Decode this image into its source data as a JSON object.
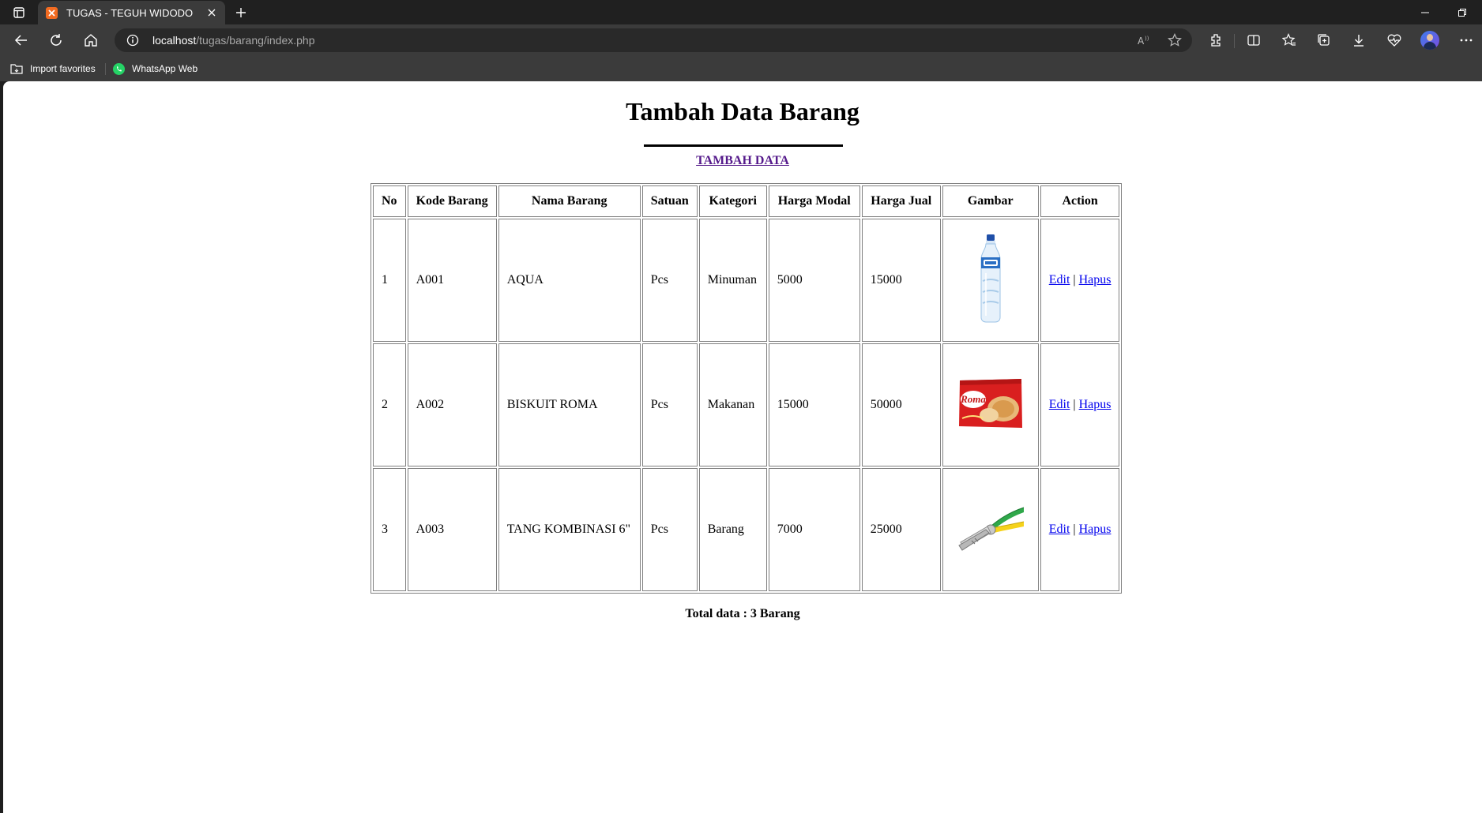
{
  "browser": {
    "tab_title": "TUGAS - TEGUH WIDODO",
    "url_host": "localhost",
    "url_path": "/tugas/barang/index.php",
    "bookmarks": [
      {
        "label": "Import favorites",
        "icon": "folder-import-icon"
      },
      {
        "label": "WhatsApp Web",
        "icon": "whatsapp-icon"
      }
    ],
    "colors": {
      "titlebar": "#202020",
      "toolbar": "#3b3b3b",
      "omnibox": "#292929",
      "favicon": "#f26b21"
    }
  },
  "page": {
    "title": "Tambah Data Barang",
    "add_link": "TAMBAH DATA",
    "headers": [
      "No",
      "Kode Barang",
      "Nama Barang",
      "Satuan",
      "Kategori",
      "Harga Modal",
      "Harga Jual",
      "Gambar",
      "Action"
    ],
    "rows": [
      {
        "no": "1",
        "kode": "A001",
        "nama": "AQUA",
        "satuan": "Pcs",
        "kategori": "Minuman",
        "modal": "5000",
        "jual": "15000",
        "image": "water-bottle-image",
        "edit": "Edit",
        "hapus": "Hapus"
      },
      {
        "no": "2",
        "kode": "A002",
        "nama": "BISKUIT ROMA",
        "satuan": "Pcs",
        "kategori": "Makanan",
        "modal": "15000",
        "jual": "50000",
        "image": "biscuit-pack-image",
        "image_text": "Roma",
        "edit": "Edit",
        "hapus": "Hapus"
      },
      {
        "no": "3",
        "kode": "A003",
        "nama": "TANG KOMBINASI 6\"",
        "satuan": "Pcs",
        "kategori": "Barang",
        "modal": "7000",
        "jual": "25000",
        "image": "pliers-image",
        "edit": "Edit",
        "hapus": "Hapus"
      }
    ],
    "action_separator": "|",
    "total": "Total data : 3 Barang"
  }
}
